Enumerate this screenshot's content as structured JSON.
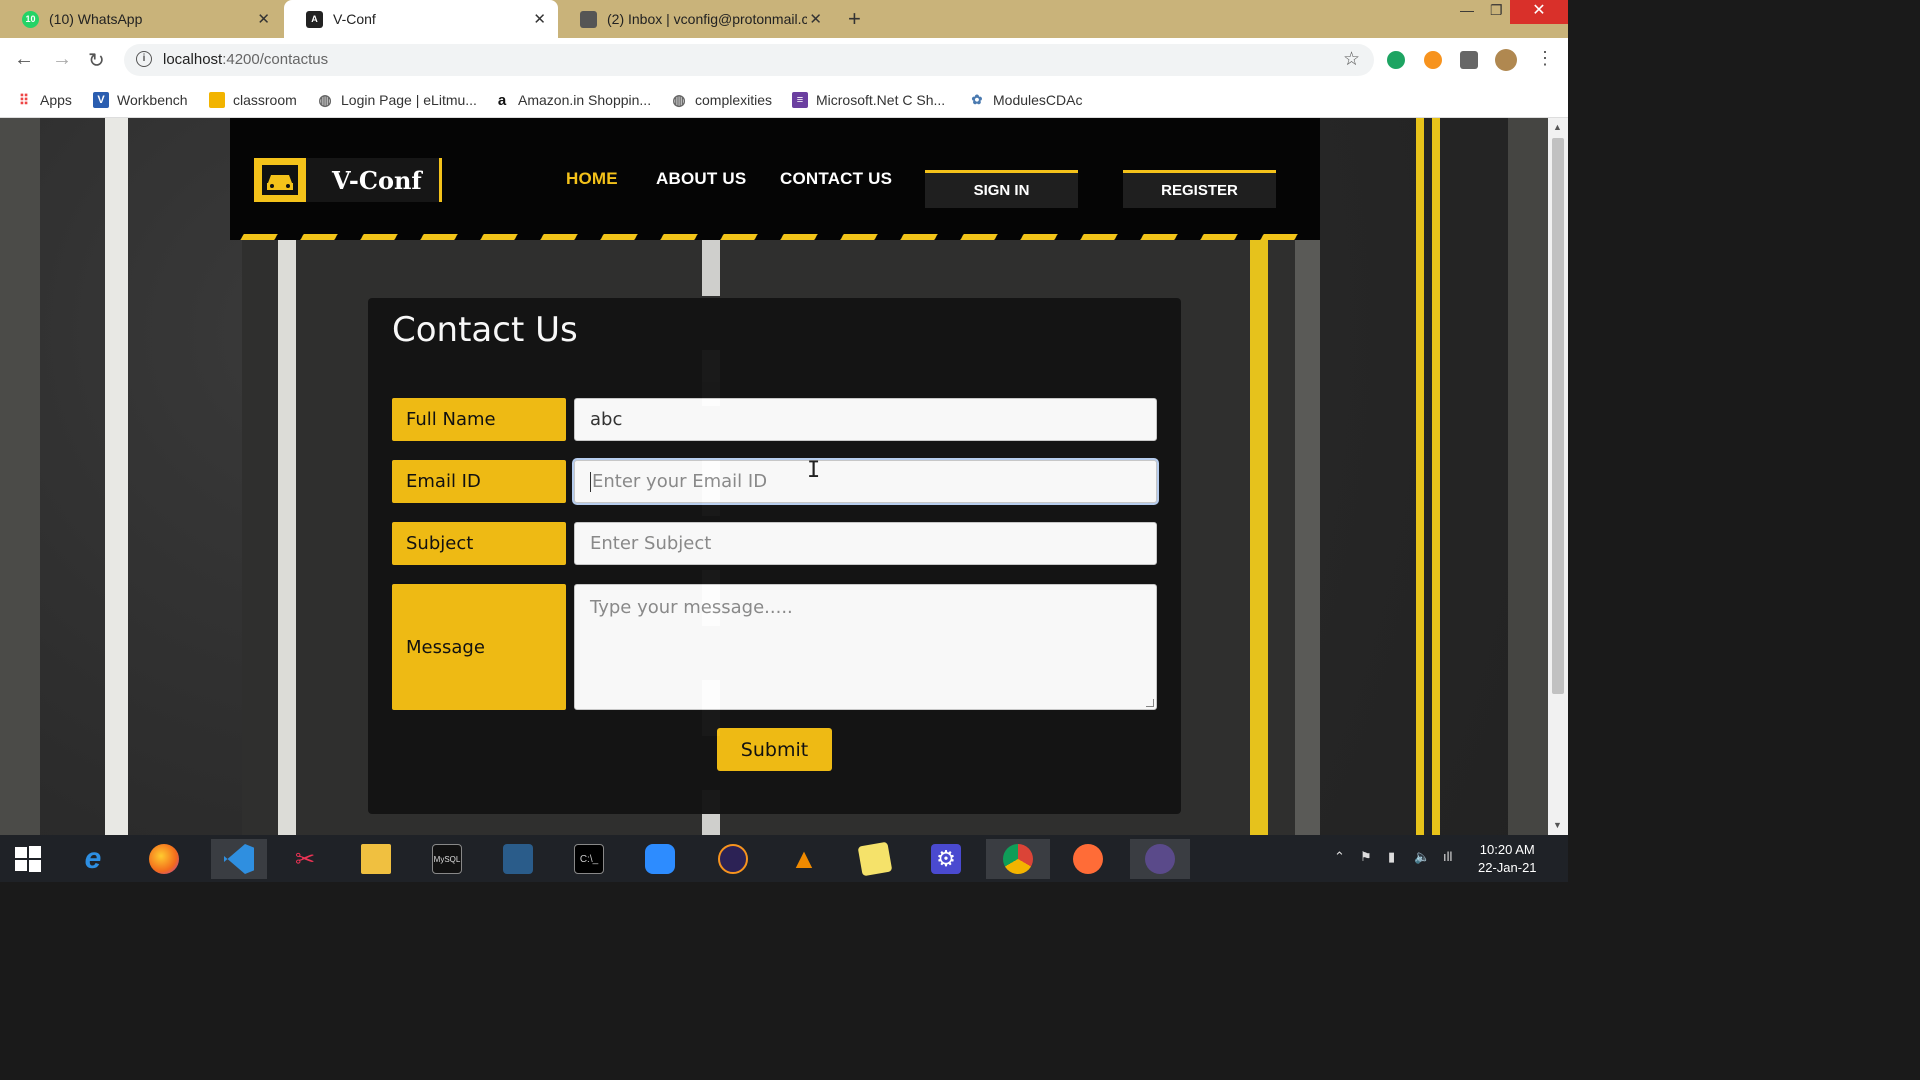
{
  "browser": {
    "tabs": [
      {
        "title": "(10) WhatsApp",
        "badge": "10",
        "active": false
      },
      {
        "title": "V-Conf",
        "active": true
      },
      {
        "title": "(2) Inbox | vconfig@protonmail.c",
        "active": false
      }
    ],
    "url_host": "localhost",
    "url_path": ":4200/contactus",
    "bookmarks": [
      {
        "label": "Apps",
        "icon": "apps-grid-icon",
        "color": "#e44"
      },
      {
        "label": "Workbench",
        "icon": "workbench-icon",
        "color": "#2a5db0"
      },
      {
        "label": "classroom",
        "icon": "classroom-icon",
        "color": "#f2b400"
      },
      {
        "label": "Login Page | eLitmu...",
        "icon": "globe-icon",
        "color": "#666"
      },
      {
        "label": "Amazon.in Shoppin...",
        "icon": "amazon-icon",
        "color": "#111"
      },
      {
        "label": "complexities",
        "icon": "globe-icon",
        "color": "#666"
      },
      {
        "label": "Microsoft.Net C Sh...",
        "icon": "list-icon",
        "color": "#6b3fa0"
      },
      {
        "label": "ModulesCDAc",
        "icon": "modules-icon",
        "color": "#4a7ab0"
      }
    ]
  },
  "site": {
    "logo_text": "V-Conf",
    "nav": [
      {
        "label": "HOME",
        "active": true
      },
      {
        "label": "ABOUT US",
        "active": false
      },
      {
        "label": "CONTACT US",
        "active": false
      }
    ],
    "sign_in": "SIGN IN",
    "register": "REGISTER"
  },
  "contact": {
    "title": "Contact Us",
    "fields": [
      {
        "label": "Full Name",
        "value": "abc",
        "placeholder": ""
      },
      {
        "label": "Email ID",
        "value": "",
        "placeholder": "Enter your Email ID"
      },
      {
        "label": "Subject",
        "value": "",
        "placeholder": "Enter Subject"
      },
      {
        "label": "Message",
        "value": "",
        "placeholder": "Type your message....."
      }
    ],
    "submit": "Submit"
  },
  "taskbar": {
    "time": "10:20 AM",
    "date": "22-Jan-21"
  },
  "colors": {
    "accent_yellow": "#f5bf14",
    "header_bg": "#050505",
    "card_bg": "#141414"
  }
}
